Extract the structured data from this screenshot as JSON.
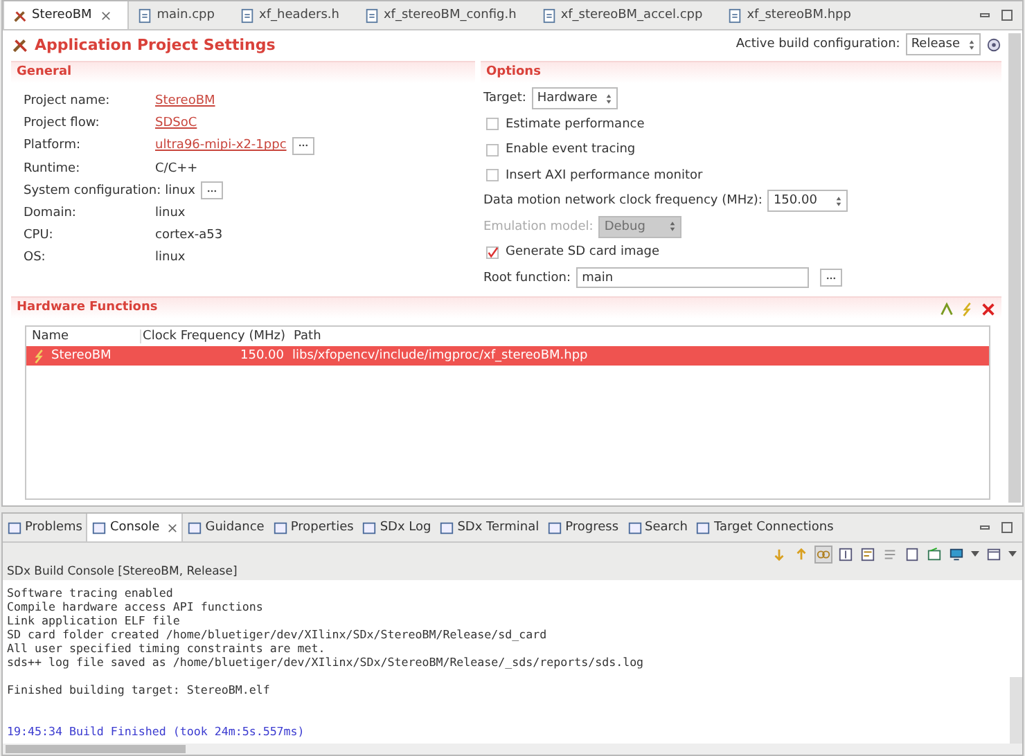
{
  "editor_tabs": [
    {
      "label": "StereoBM",
      "selected": true
    },
    {
      "label": "main.cpp",
      "selected": false
    },
    {
      "label": "xf_headers.h",
      "selected": false
    },
    {
      "label": "xf_stereoBM_config.h",
      "selected": false
    },
    {
      "label": "xf_stereoBM_accel.cpp",
      "selected": false
    },
    {
      "label": "xf_stereoBM.hpp",
      "selected": false
    }
  ],
  "title": "Application Project Settings",
  "build_config": {
    "label": "Active build configuration:",
    "value": "Release"
  },
  "general": {
    "title": "General",
    "rows": [
      {
        "label": "Project name:",
        "value": "StereoBM",
        "kind": "link",
        "browse": false
      },
      {
        "label": "Project flow:",
        "value": "SDSoC",
        "kind": "link",
        "browse": false
      },
      {
        "label": "Platform:",
        "value": "ultra96-mipi-x2-1ppc",
        "kind": "link",
        "browse": true
      },
      {
        "label": "Runtime:",
        "value": "C/C++",
        "kind": "text",
        "browse": false
      },
      {
        "label": "System configuration:",
        "value": "linux",
        "kind": "text",
        "browse": true
      },
      {
        "label": "Domain:",
        "value": "linux",
        "kind": "text",
        "browse": false
      },
      {
        "label": "CPU:",
        "value": "cortex-a53",
        "kind": "text",
        "browse": false
      },
      {
        "label": "OS:",
        "value": "linux",
        "kind": "text",
        "browse": false
      }
    ]
  },
  "options": {
    "title": "Options",
    "items": [
      {
        "kind": "select",
        "label": "Target:",
        "value": "Hardware",
        "disabled": false
      },
      {
        "kind": "checkbox",
        "label": "Estimate performance",
        "checked": false
      },
      {
        "kind": "checkbox",
        "label": "Enable event tracing",
        "checked": false
      },
      {
        "kind": "checkbox",
        "label": "Insert AXI performance monitor",
        "checked": false
      },
      {
        "kind": "spinner",
        "label": "Data motion network clock frequency (MHz):",
        "value": "150.00"
      },
      {
        "kind": "select",
        "label": "Emulation model:",
        "value": "Debug",
        "disabled": true
      },
      {
        "kind": "checkbox",
        "label": "Generate SD card image",
        "checked": true
      },
      {
        "kind": "text",
        "label": "Root function:",
        "value": "main"
      }
    ]
  },
  "hardware_functions": {
    "title": "Hardware Functions",
    "columns": [
      "Name",
      "Clock Frequency (MHz)",
      "Path"
    ],
    "rows": [
      {
        "name": "StereoBM",
        "clock": "150.00",
        "path": "libs/xfopencv/include/imgproc/xf_stereoBM.hpp",
        "selected": true
      }
    ]
  },
  "bottom_tabs": [
    {
      "label": "Problems",
      "selected": false
    },
    {
      "label": "Console",
      "selected": true
    },
    {
      "label": "Guidance",
      "selected": false
    },
    {
      "label": "Properties",
      "selected": false
    },
    {
      "label": "SDx Log",
      "selected": false
    },
    {
      "label": "SDx Terminal",
      "selected": false
    },
    {
      "label": "Progress",
      "selected": false
    },
    {
      "label": "Search",
      "selected": false
    },
    {
      "label": "Target Connections",
      "selected": false
    }
  ],
  "console": {
    "title": "SDx Build Console [StereoBM, Release]",
    "lines": [
      {
        "text": "Software tracing enabled",
        "kind": "normal"
      },
      {
        "text": "Compile hardware access API functions",
        "kind": "normal"
      },
      {
        "text": "Link application ELF file",
        "kind": "normal"
      },
      {
        "text": "SD card folder created /home/bluetiger/dev/XIlinx/SDx/StereoBM/Release/sd_card",
        "kind": "normal"
      },
      {
        "text": "All user specified timing constraints are met.",
        "kind": "normal"
      },
      {
        "text": "sds++ log file saved as /home/bluetiger/dev/XIlinx/SDx/StereoBM/Release/_sds/reports/sds.log",
        "kind": "normal"
      },
      {
        "kind": "blank"
      },
      {
        "text": "Finished building target: StereoBM.elf",
        "kind": "normal"
      },
      {
        "kind": "blank"
      },
      {
        "kind": "blank"
      },
      {
        "text": "19:45:34 Build Finished (took 24m:5s.557ms)",
        "kind": "info"
      }
    ]
  }
}
